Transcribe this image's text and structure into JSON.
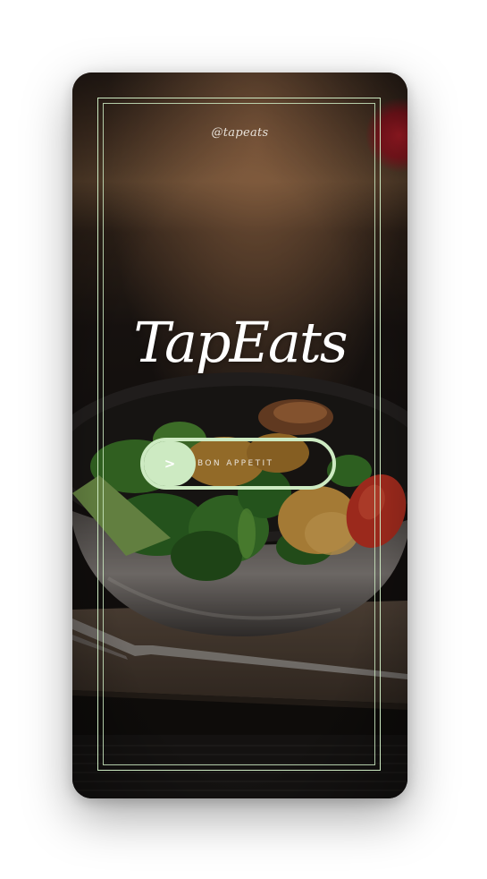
{
  "app": {
    "handle": "@tapeats",
    "title": "TapEats"
  },
  "slider": {
    "knob_symbol": ">",
    "label": "BON APPETIT",
    "progress": 0
  },
  "colors": {
    "accent": "#cdeac2",
    "text": "#ffffff",
    "background": "#1b1512"
  },
  "background_image": {
    "icon": "salad-bowl-photo"
  }
}
